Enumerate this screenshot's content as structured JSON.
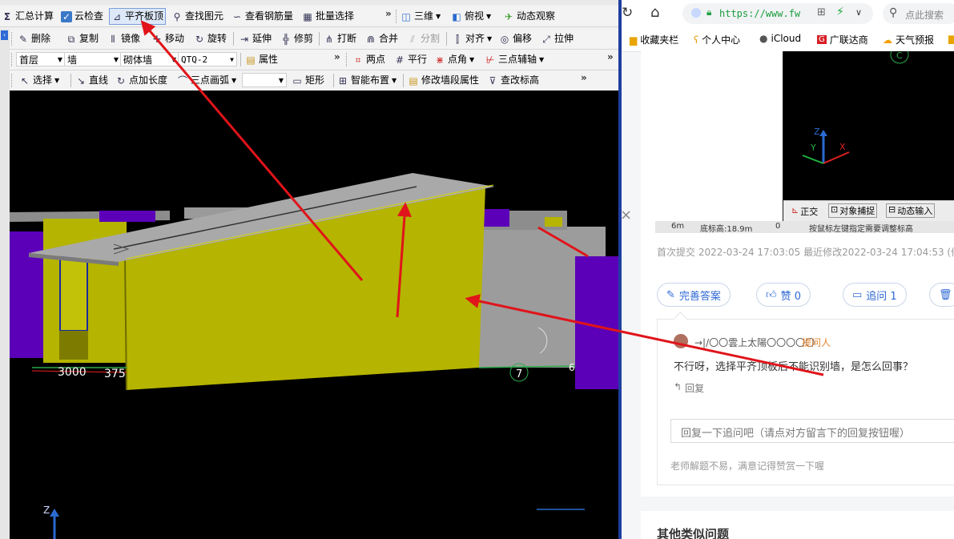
{
  "cad": {
    "row1": {
      "summary": "汇总计算",
      "cloud_check": "云检查",
      "align_slab": "平齐板顶",
      "find_element": "查找图元",
      "view_rebar": "查看钢筋量",
      "batch_select": "批量选择",
      "more": "»",
      "view_3d": "三维",
      "top_view": "俯视",
      "dynamic_view": "动态观察"
    },
    "row2": {
      "delete": "删除",
      "copy": "复制",
      "mirror": "镜像",
      "move": "移动",
      "rotate": "旋转",
      "extend": "延伸",
      "trim": "修剪",
      "break": "打断",
      "merge": "合并",
      "split": "分割",
      "align": "对齐",
      "offset": "偏移",
      "stretch": "拉伸"
    },
    "row3": {
      "floor": "首层",
      "element": "墙",
      "wall_type": "砌体墙",
      "wall_code": "QTQ-2",
      "properties": "属性",
      "more": "»",
      "two_points": "两点",
      "parallel": "平行",
      "point_angle": "点角",
      "three_point_axis": "三点辅轴",
      "more2": "»"
    },
    "row4": {
      "select": "选择",
      "line": "直线",
      "point_length": "点加长度",
      "three_point_arc": "三点画弧",
      "rectangle": "矩形",
      "smart_layout": "智能布置",
      "modify_wall_attr": "修改墙段属性",
      "check_elevation": "查改标高",
      "more": "»"
    },
    "viewport": {
      "dim_3000": "3000",
      "dim_375": "375",
      "axis_7": "7",
      "axis_6": "6",
      "z_label": "Z"
    }
  },
  "browser": {
    "url": "https://www.fw",
    "search_placeholder": "点此搜索",
    "bookmarks": [
      "收藏夹栏",
      "个人中心",
      "iCloud",
      "广联达商",
      "天气预报"
    ],
    "cad_thumb": {
      "ortho": "正交",
      "snap": "对象捕捉",
      "dyn_input": "动态输入",
      "status_a": "6m",
      "status_b": "底标高:18.9m",
      "status_c": "0",
      "status_d": "按鼠标左键指定需要调整标高",
      "axis_c": "C",
      "axis_z": "Z",
      "axis_y": "Y",
      "axis_x": "X"
    },
    "close_symbol": "×",
    "meta": {
      "first_submit_label": "首次提交",
      "first_submit": "2022-03-24 17:03:05",
      "last_modified_label": "最近修改",
      "last_modified": "2022-03-24 17:04:53",
      "extra": "(修改"
    },
    "actions": {
      "improve": "完善答案",
      "like": "赞 0",
      "follow_up": "追问 1"
    },
    "comment": {
      "user": "→|/〇〇雲上太陽〇〇〇〇〇",
      "role": "提问人",
      "text": "不行呀，选择平齐顶板后不能识别墙，是怎么回事？",
      "reply": "回复",
      "reply_placeholder": "回复一下追问吧（请点对方留言下的回复按钮喔）",
      "tip": "老师解题不易，满意记得赞赏一下喔"
    },
    "similar_title": "其他类似问题"
  },
  "colors": {
    "wall_yellow": "#b5b400",
    "slab_gray": "#a9a9a9",
    "column_purple": "#5a00b8",
    "annotation_red": "#e0141a",
    "link_blue": "#2f69d6",
    "divider_blue": "#1f3fa0"
  }
}
